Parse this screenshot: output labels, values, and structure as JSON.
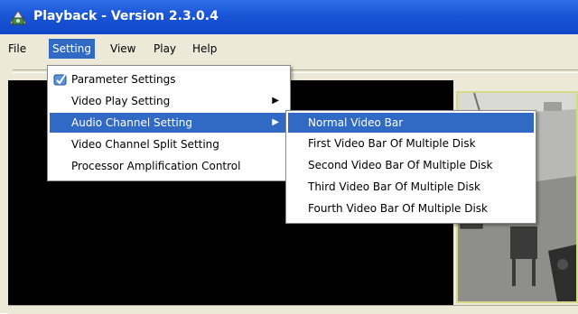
{
  "window": {
    "title": "Playback - Version 2.3.0.4"
  },
  "menubar": {
    "items": [
      {
        "label": "File"
      },
      {
        "label": "Setting"
      },
      {
        "label": "View"
      },
      {
        "label": "Play"
      },
      {
        "label": "Help"
      }
    ]
  },
  "setting_menu": {
    "items": [
      {
        "label": "Parameter Settings",
        "icon": "settings-icon"
      },
      {
        "label": "Video Play Setting",
        "has_submenu": true
      },
      {
        "label": "Audio Channel Setting",
        "has_submenu": true,
        "highlighted": true
      },
      {
        "label": "Video Channel Split Setting"
      },
      {
        "label": "Processor Amplification Control"
      }
    ]
  },
  "audio_submenu": {
    "items": [
      {
        "label": "Normal Video Bar",
        "highlighted": true
      },
      {
        "label": "First Video Bar Of Multiple Disk"
      },
      {
        "label": "Second Video Bar Of Multiple Disk"
      },
      {
        "label": "Third Video Bar Of Multiple Disk"
      },
      {
        "label": "Fourth Video Bar Of Multiple Disk"
      }
    ]
  },
  "colors": {
    "titlebar": "#1a55d6",
    "highlight": "#316ac5",
    "chrome": "#ece9d8",
    "video_bg": "#000000",
    "cam_border": "#d8d88a"
  }
}
